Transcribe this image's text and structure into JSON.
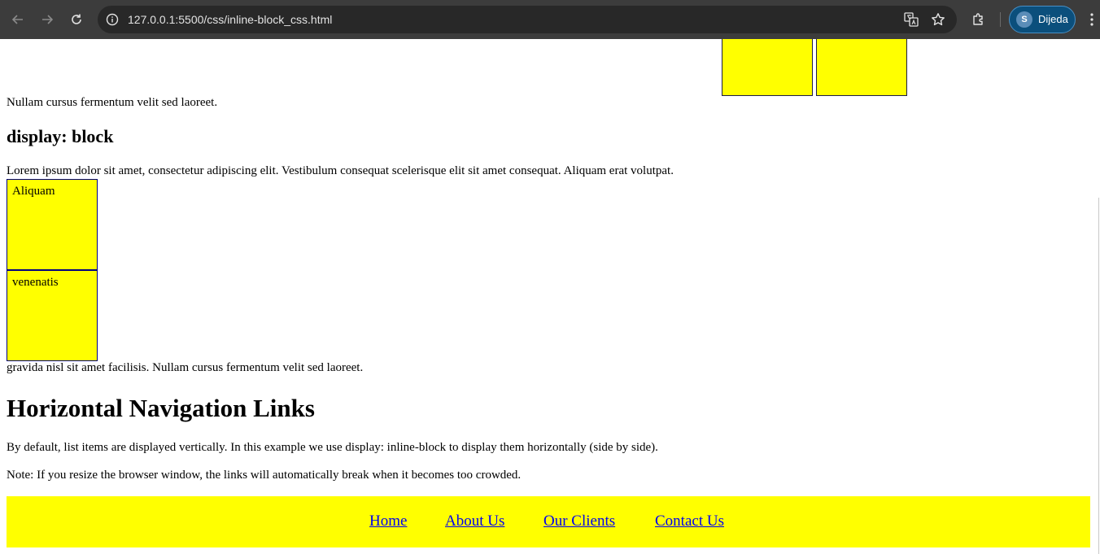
{
  "browser": {
    "url": "127.0.0.1:5500/css/inline-block_css.html",
    "profile_initial": "S",
    "profile_name": "Dijeda",
    "icons": [
      "back-icon",
      "forward-icon",
      "reload-icon",
      "site-info-icon",
      "translate-icon",
      "bookmark-star-icon",
      "extensions-icon",
      "menu-icon"
    ]
  },
  "page": {
    "para_top": "Nullam cursus fermentum velit sed laoreet.",
    "block_heading": "display: block",
    "block_para": "Lorem ipsum dolor sit amet, consectetur adipiscing elit. Vestibulum consequat scelerisque elit sit amet consequat. Aliquam erat volutpat.",
    "block_boxes": [
      "Aliquam",
      "venenatis"
    ],
    "block_after": "gravida nisl sit amet facilisis. Nullam cursus fermentum velit sed laoreet.",
    "nav_heading": "Horizontal Navigation Links",
    "nav_para1": "By default, list items are displayed vertically. In this example we use display: inline-block to display them horizontally (side by side).",
    "nav_para2": "Note: If you resize the browser window, the links will automatically break when it becomes too crowded.",
    "nav_links": [
      "Home",
      "About Us",
      "Our Clients",
      "Contact Us"
    ]
  },
  "colors": {
    "highlight": "#ffff00",
    "link": "#0000ee",
    "chrome": "#3c3c3c"
  }
}
